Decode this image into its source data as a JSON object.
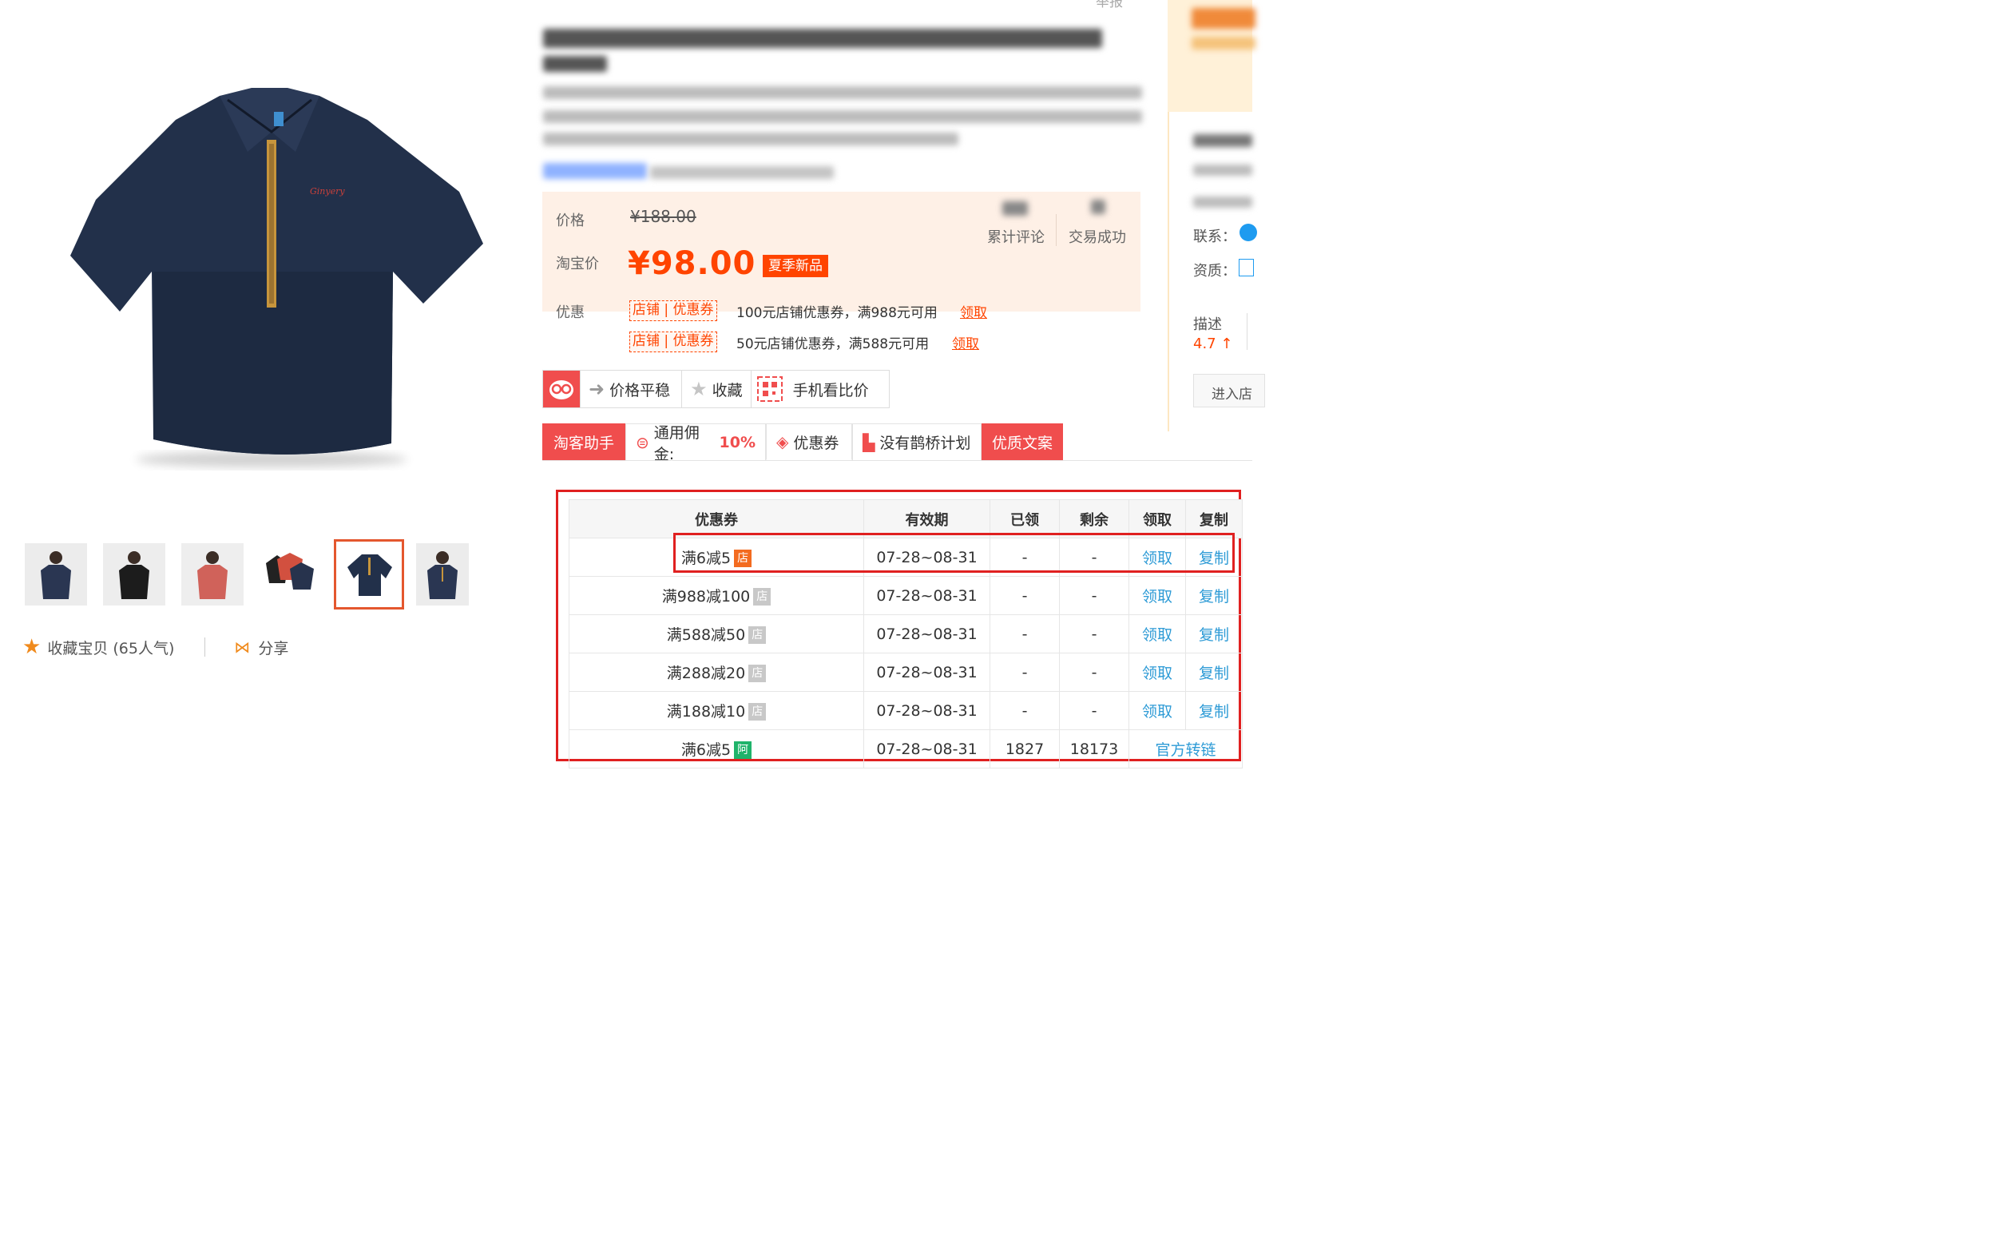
{
  "top": {
    "report_label": "举报"
  },
  "gallery": {
    "thumbnails": [
      "blue-polo-front",
      "black-polo-model",
      "red-polo-model",
      "polo-pair",
      "navy-polo-flat",
      "navy-polo-model"
    ],
    "favorite_label": "收藏宝贝 (65人气)",
    "share_label": "分享"
  },
  "price": {
    "orig_label": "价格",
    "orig_value": "¥188.00",
    "taobao_label": "淘宝价",
    "taobao_value": "¥98.00",
    "season_tag": "夏季新品",
    "comments_label": "累计评论",
    "trades_label": "交易成功",
    "promo_label": "优惠",
    "coupon_chip": "店铺 | 优惠券",
    "coupons": [
      {
        "text": "100元店铺优惠券，满988元可用",
        "link": "领取"
      },
      {
        "text": "50元店铺优惠券，满588元可用",
        "link": "领取"
      }
    ]
  },
  "toolbar": {
    "price_stable": "价格平稳",
    "favorite": "收藏",
    "mobile_compare": "手机看比价"
  },
  "tabs": [
    {
      "label": "淘客助手"
    },
    {
      "label": "通用佣金:",
      "value": "10%"
    },
    {
      "label": "优惠券"
    },
    {
      "label": "没有鹊桥计划"
    },
    {
      "label": "优质文案"
    }
  ],
  "coupon_table": {
    "headers": [
      "优惠券",
      "有效期",
      "已领",
      "剩余",
      "领取",
      "复制"
    ],
    "rows": [
      {
        "name": "满6减5",
        "badge": "店",
        "period": "07-28~08-31",
        "claimed": "-",
        "remaining": "-",
        "get": "领取",
        "copy": "复制"
      },
      {
        "name": "满988减100",
        "badge": "店",
        "period": "07-28~08-31",
        "claimed": "-",
        "remaining": "-",
        "get": "领取",
        "copy": "复制"
      },
      {
        "name": "满588减50",
        "badge": "店",
        "period": "07-28~08-31",
        "claimed": "-",
        "remaining": "-",
        "get": "领取",
        "copy": "复制"
      },
      {
        "name": "满288减20",
        "badge": "店",
        "period": "07-28~08-31",
        "claimed": "-",
        "remaining": "-",
        "get": "领取",
        "copy": "复制"
      },
      {
        "name": "满188减10",
        "badge": "店",
        "period": "07-28~08-31",
        "claimed": "-",
        "remaining": "-",
        "get": "领取",
        "copy": "复制"
      },
      {
        "name": "满6减5",
        "badge": "阿",
        "period": "07-28~08-31",
        "claimed": "1827",
        "remaining": "18173",
        "official_link": "官方转链"
      }
    ]
  },
  "sidebar": {
    "contact_label": "联系：",
    "qualification_label": "资质：",
    "describe_label": "描述",
    "describe_score": "4.7",
    "enter_store": "进入店"
  },
  "colors": {
    "accent": "#ff4400",
    "link_blue": "#2e9bd6",
    "highlight_red": "#e02020",
    "tab_red": "#f04d4d"
  }
}
